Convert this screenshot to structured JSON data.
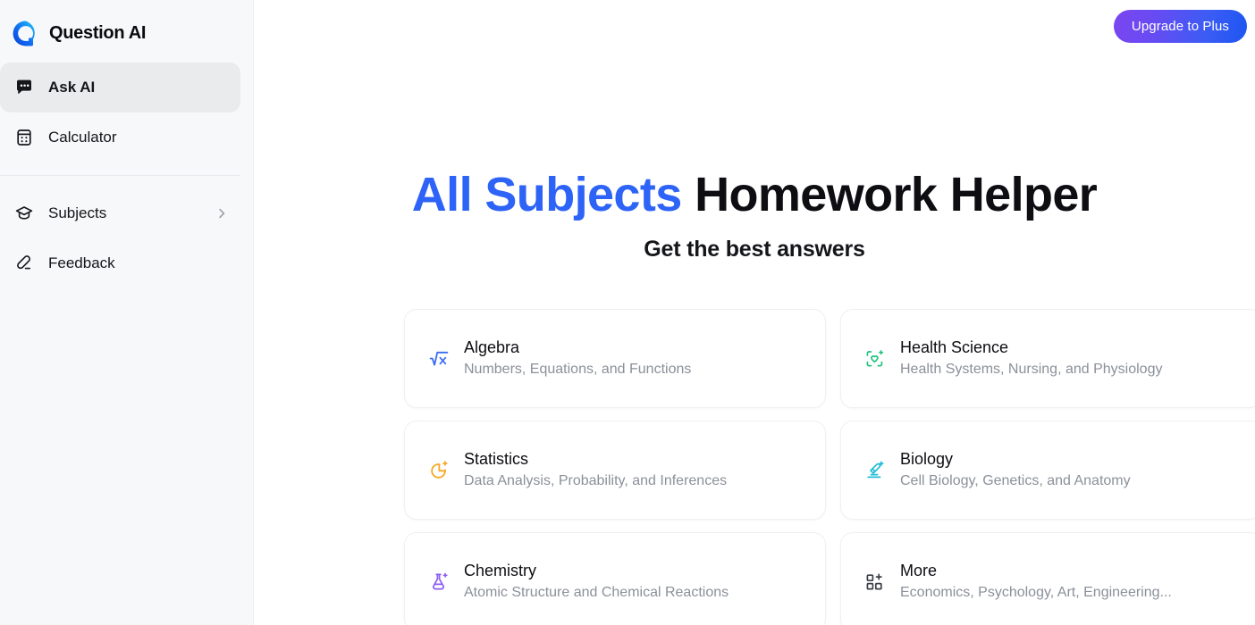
{
  "brand": {
    "name": "Question AI",
    "logo_icon": "question-ai-logo"
  },
  "sidebar": {
    "primary_items": [
      {
        "label": "Ask AI",
        "icon": "chat-bubble-icon",
        "active": true
      },
      {
        "label": "Calculator",
        "icon": "calculator-icon",
        "active": false
      }
    ],
    "secondary_items": [
      {
        "label": "Subjects",
        "icon": "graduation-cap-icon",
        "chevron": "chevron-right-icon"
      },
      {
        "label": "Feedback",
        "icon": "pencil-icon"
      }
    ]
  },
  "header": {
    "upgrade_label": "Upgrade to Plus",
    "upgrade_gradient_from": "#7B46F0",
    "upgrade_gradient_to": "#1D55F2"
  },
  "hero": {
    "title_accent": "All Subjects",
    "title_rest": " Homework Helper",
    "accent_color": "#2D63F6",
    "subtitle": "Get the best answers"
  },
  "subjects": [
    {
      "title": "Algebra",
      "desc": "Numbers, Equations, and Functions",
      "icon": "square-root-x-icon",
      "color": "#3B6BF0"
    },
    {
      "title": "Health Science",
      "desc": "Health Systems, Nursing, and Physiology",
      "icon": "heart-scan-icon",
      "color": "#22C37E"
    },
    {
      "title": "Statistics",
      "desc": "Data Analysis, Probability, and Inferences",
      "icon": "pie-chart-icon",
      "color": "#F7A823"
    },
    {
      "title": "Biology",
      "desc": "Cell Biology, Genetics, and Anatomy",
      "icon": "microscope-icon",
      "color": "#22BDD6"
    },
    {
      "title": "Chemistry",
      "desc": "Atomic Structure and Chemical Reactions",
      "icon": "flask-icon",
      "color": "#8B5CF6"
    },
    {
      "title": "More",
      "desc": "Economics, Psychology, Art, Engineering...",
      "icon": "grid-squares-icon",
      "color": "#3A3F47"
    }
  ]
}
